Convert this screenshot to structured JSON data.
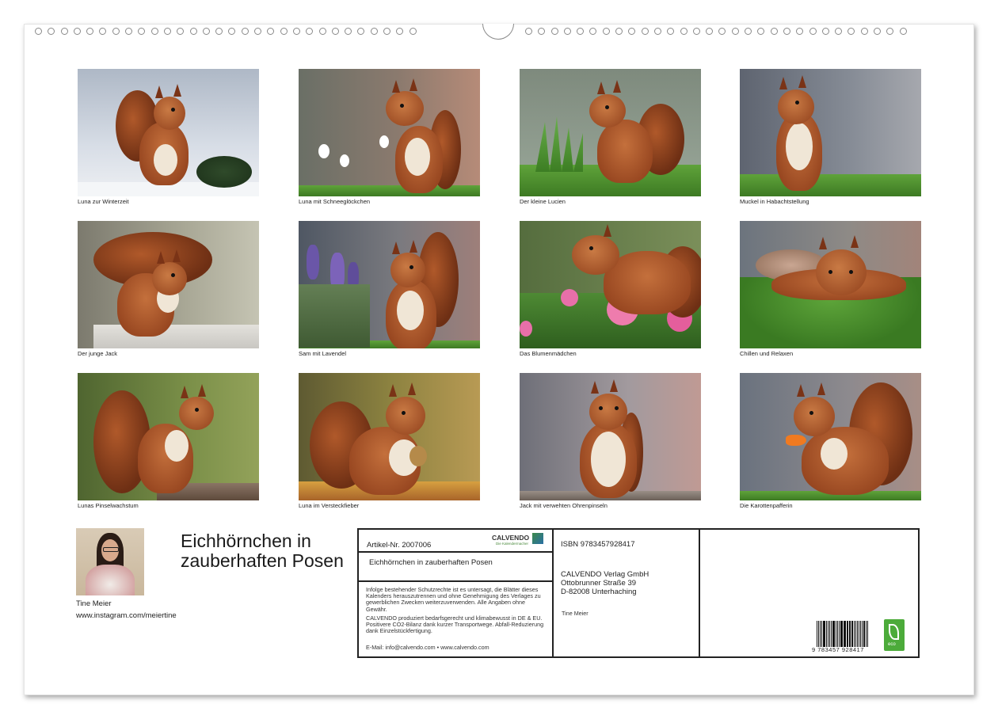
{
  "captions": [
    "Luna zur Winterzeit",
    "Luna mit Schneeglöckchen",
    "Der kleine Lucien",
    "Muckel in Habachtstellung",
    "Der junge Jack",
    "Sam mit Lavendel",
    "Das Blumenmädchen",
    "Chillen und Relaxen",
    "Lunas Pinselwachstum",
    "Luna im Versteckfieber",
    "Jack mit verwehten Ohrenpinseln",
    "Die Karottenpafferin"
  ],
  "author": {
    "name": "Tine Meier",
    "instagram": "www.instagram.com/meiertine"
  },
  "title": "Eichhörnchen in zauberhaften Posen",
  "info": {
    "article": "Artikel-Nr. 2007006",
    "calvendo_logo": "CALVENDO",
    "calvendo_sub": "Die Kalendermacher",
    "subtitle": "Eichhörnchen in zauberhaften Posen",
    "legal": "Infolge bestehender Schutzrechte ist es untersagt, die Blätter dieses Kalenders herauszutrennen und ohne Genehmigung des Verlages zu gewerblichen Zwecken weiterzuverwenden. Alle Angaben ohne Gewähr.",
    "eco_text": "CALVENDO produziert bedarfsgerecht und klimabewusst in DE & EU. Positivere CO2-Bilanz dank kurzer Transportwege. Abfall-Reduzierung dank Einzelstückfertigung.",
    "contact": "E-Mail: info@calvendo.com • www.calvendo.com",
    "isbn": "ISBN 9783457928417",
    "publisher_line1": "CALVENDO Verlag GmbH",
    "publisher_line2": "Ottobrunner Straße 39",
    "publisher_line3": "D-82008 Unterhaching",
    "author_small": "Tine Meier",
    "barcode_number": "9 783457 928417",
    "eco_label": "eco"
  },
  "colors": {
    "fur": "#b0592a",
    "grass": "#4f8f2e",
    "eco_green": "#4cab3a"
  }
}
